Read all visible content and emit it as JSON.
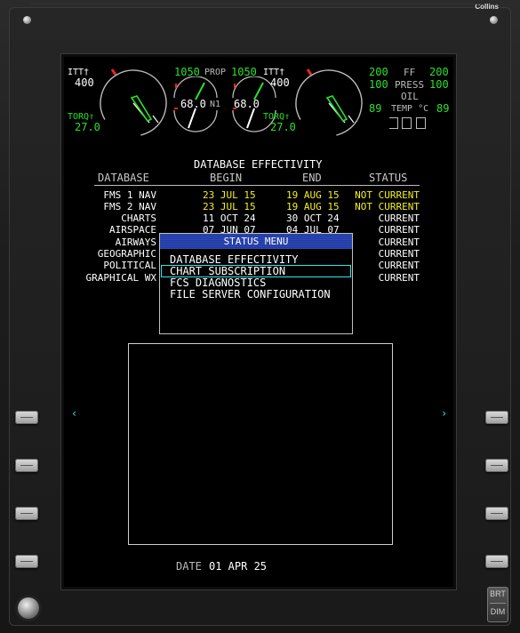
{
  "brand": "Collins",
  "engine_display": {
    "left": {
      "itt_label": "ITT",
      "itt_value": "400",
      "torq_label": "TORQ",
      "torq_value": "27.0"
    },
    "right": {
      "itt_label": "ITT",
      "itt_value": "400",
      "torq_label": "TORQ",
      "torq_value": "27.0"
    },
    "prop": {
      "label": "PROP",
      "left_value": "1050",
      "right_value": "1050"
    },
    "n1": {
      "label": "N1",
      "left_value": "68.0",
      "right_value": "68.0"
    },
    "ff": {
      "label": "FF",
      "left_value": "200",
      "right_value": "200"
    },
    "oil_press": {
      "label": "PRESS",
      "left_value": "100",
      "right_value": "100"
    },
    "oil_label": "OIL",
    "oil_temp": {
      "label": "TEMP °C",
      "left_value": "89",
      "right_value": "89"
    }
  },
  "effectivity": {
    "title": "DATABASE EFFECTIVITY",
    "headers": {
      "database": "DATABASE",
      "begin": "BEGIN",
      "end": "END",
      "status": "STATUS"
    },
    "rows": [
      {
        "database": "FMS 1 NAV",
        "begin": "23 JUL 15",
        "end": "19 AUG 15",
        "status": "NOT CURRENT"
      },
      {
        "database": "FMS 2 NAV",
        "begin": "23 JUL 15",
        "end": "19 AUG 15",
        "status": "NOT CURRENT"
      },
      {
        "database": "CHARTS",
        "begin": "11 OCT 24",
        "end": "30 OCT 24",
        "status": "CURRENT"
      },
      {
        "database": "AIRSPACE",
        "begin": "07 JUN 07",
        "end": "04 JUL 07",
        "status": "CURRENT"
      },
      {
        "database": "AIRWAYS",
        "begin": "",
        "end": "",
        "status": "CURRENT"
      },
      {
        "database": "GEOGRAPHIC",
        "begin": "",
        "end": "",
        "status": "CURRENT"
      },
      {
        "database": "POLITICAL",
        "begin": "",
        "end": "",
        "status": "CURRENT"
      },
      {
        "database": "GRAPHICAL WX",
        "begin": "",
        "end": "",
        "status": "CURRENT"
      }
    ]
  },
  "status_menu": {
    "title": "STATUS MENU",
    "items": [
      "DATABASE EFFECTIVITY",
      "CHART SUBSCRIPTION",
      "FCS DIAGNOSTICS",
      "FILE SERVER CONFIGURATION"
    ],
    "selected_index": 1
  },
  "date": {
    "label": "DATE",
    "value": "01 APR 25"
  },
  "nav": {
    "left_chevron": "‹",
    "right_chevron": "›"
  },
  "brt_dim": {
    "brt": "BRT",
    "dim": "DIM"
  },
  "colors": {
    "green": "#2be02b",
    "yellow": "#f3f020",
    "cyan": "#2ee6e6",
    "menu_title_bg": "#1e3aa8"
  }
}
